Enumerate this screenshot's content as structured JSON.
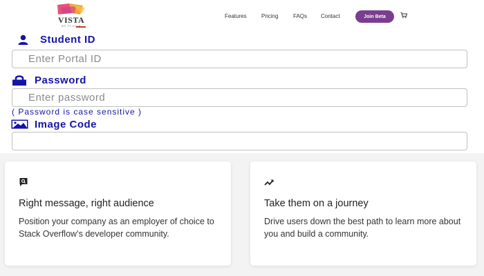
{
  "header": {
    "logo_text": "VISTA",
    "logo_subtext": "WP PLUGIN",
    "nav": [
      "Features",
      "Pricing",
      "FAQs",
      "Contact"
    ],
    "join_label": "Join Beta",
    "cart_icon": "cart-icon"
  },
  "form": {
    "student_id_label": "Student ID",
    "student_id_icon": "user-icon",
    "student_id_placeholder": "Enter Portal ID",
    "password_label": "Password",
    "password_icon": "lock-icon",
    "password_placeholder": "Enter password",
    "password_hint": "( Password is case sensitive )",
    "image_code_label": "Image Code",
    "image_code_icon": "image-icon",
    "image_code_placeholder": ""
  },
  "cards": [
    {
      "icon": "speech-bubble-icon",
      "title": "Right message, right audience",
      "body": "Position your company as an employer of choice to Stack Overflow’s developer community."
    },
    {
      "icon": "trending-up-icon",
      "title": "Take them on a journey",
      "body": "Drive users down the best path to learn more about you and build a community."
    }
  ],
  "colors": {
    "form_label": "#1414a8",
    "join_button": "#7a3e8e",
    "logo_accent": "#c0392b"
  }
}
